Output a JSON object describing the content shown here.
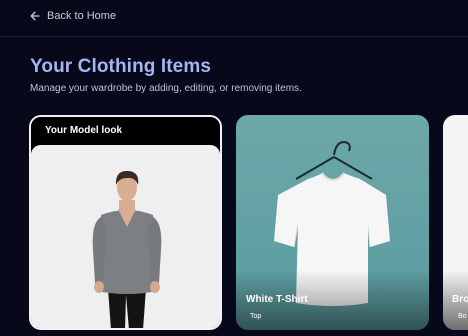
{
  "nav": {
    "back_label": "Back to Home"
  },
  "header": {
    "title": "Your Clothing Items",
    "subtitle": "Manage your wardrobe by adding, editing, or removing items."
  },
  "cards": [
    {
      "label": "Your Model look"
    },
    {
      "name": "White T-Shirt",
      "category": "Top"
    },
    {
      "name": "Bro",
      "category": "Bo"
    }
  ],
  "colors": {
    "background": "#07091a",
    "title": "#a6b4f2",
    "tshirt_card": "#629fa1"
  },
  "icons": {
    "back": "arrow-left-icon"
  }
}
